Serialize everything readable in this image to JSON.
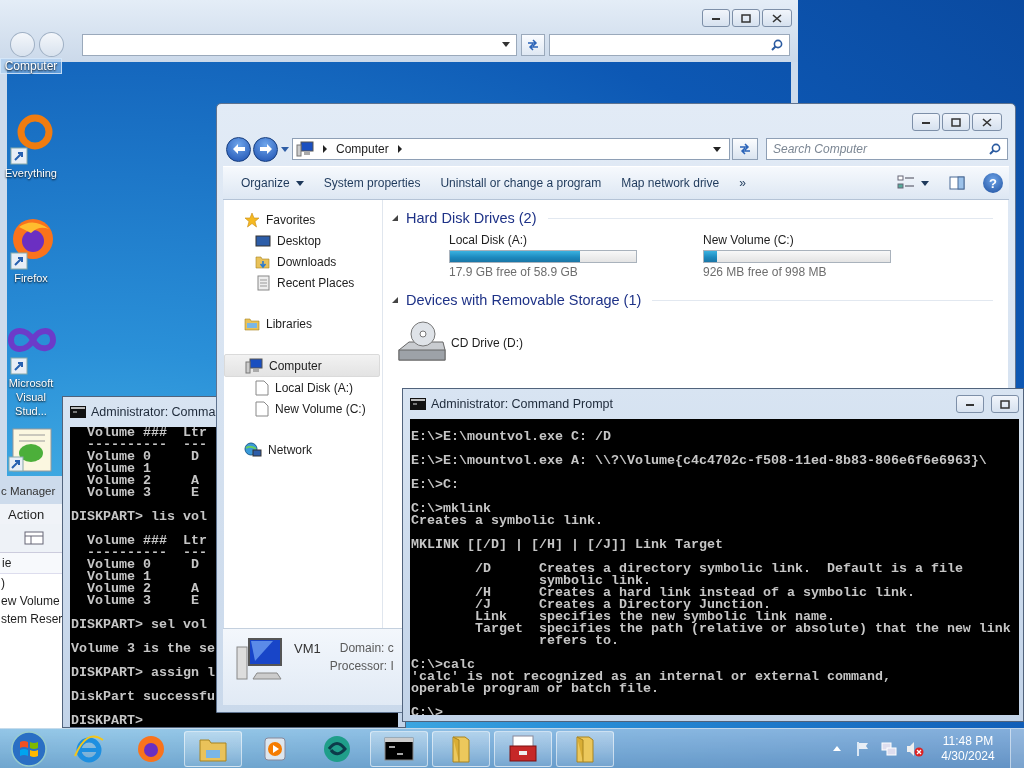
{
  "desktop": {
    "selected_label": "Computer",
    "icons": [
      {
        "kind": "ring",
        "label": "Everything"
      },
      {
        "kind": "globe",
        "label": "Firefox"
      },
      {
        "kind": "infinity",
        "label": "Microsoft Visual Stud..."
      },
      {
        "kind": "notepad"
      }
    ]
  },
  "disk_management": {
    "title": "c Manager",
    "menu": [
      "Action"
    ],
    "column_header": "ie",
    "rows": [
      ")",
      "ew Volume",
      "stem Reser"
    ]
  },
  "diskpart_console": {
    "title": "Administrator: Comma",
    "blocks": [
      [
        "  Volume ###  Ltr",
        "  ----------  ---",
        "  Volume 0     D",
        "  Volume 1",
        "  Volume 2     A",
        "  Volume 3     E"
      ],
      [
        "DISKPART> lis vol"
      ],
      [
        "  Volume ###  Ltr",
        "  ----------  ---",
        "  Volume 0     D",
        "  Volume 1",
        "  Volume 2     A",
        "  Volume 3     E"
      ],
      [
        "DISKPART> sel vol"
      ],
      [
        "Volume 3 is the se"
      ],
      [
        "DISKPART> assign l"
      ],
      [
        "DiskPart successfu"
      ],
      [
        "DISKPART>"
      ]
    ]
  },
  "explorer": {
    "breadcrumb": [
      "Computer"
    ],
    "search": {
      "placeholder": "Search Computer"
    },
    "toolbar": [
      {
        "label": "Organize",
        "dropdown": true
      },
      {
        "label": "System properties",
        "dropdown": false
      },
      {
        "label": "Uninstall or change a program",
        "dropdown": false
      },
      {
        "label": "Map network drive",
        "dropdown": false
      },
      {
        "label": "»",
        "dropdown": false
      }
    ],
    "help": "?",
    "nav": [
      {
        "kind": "star",
        "label": "Favorites",
        "selected": false,
        "children": [
          {
            "kind": "desktop",
            "label": "Desktop",
            "selected": false
          },
          {
            "kind": "downloads",
            "label": "Downloads",
            "selected": false
          },
          {
            "kind": "recent",
            "label": "Recent Places",
            "selected": false
          }
        ]
      },
      {
        "kind": "libraries",
        "label": "Libraries",
        "selected": false
      },
      {
        "kind": "computer",
        "label": "Computer",
        "selected": true,
        "children": [
          {
            "kind": "page",
            "label": "Local Disk (A:)",
            "selected": false
          },
          {
            "kind": "page",
            "label": "New Volume (C:)",
            "selected": false
          }
        ]
      },
      {
        "kind": "network",
        "label": "Network",
        "selected": false
      }
    ],
    "sections": [
      {
        "title": "Hard Disk Drives (2)",
        "expanded": true,
        "items": [
          {
            "kind": "hard-disk",
            "name": "Local Disk (A:)",
            "level": 0.7,
            "free": "17.9 GB free of 58.9 GB"
          },
          {
            "kind": "hard-disk",
            "name": "New Volume (C:)",
            "level": 0.07,
            "free": "926 MB free of 998 MB"
          }
        ]
      },
      {
        "title": "Devices with Removable Storage (1)",
        "expanded": true,
        "items": [
          {
            "kind": "cd-drive",
            "name": "CD Drive (D:)"
          }
        ]
      }
    ],
    "details": {
      "name": "VM1",
      "fields": [
        "Domain: c",
        "Processor: I"
      ]
    }
  },
  "console": {
    "title": "Administrator: Command Prompt",
    "blocks": [
      [
        "E:\\>E:\\mountvol.exe C: /D"
      ],
      [
        "E:\\>E:\\mountvol.exe A: \\\\?\\Volume{c4c4702c-f508-11ed-8b83-806e6f6e6963}\\"
      ],
      [
        "E:\\>C:"
      ],
      [
        "C:\\>mklink",
        "Creates a symbolic link."
      ],
      [
        "MKLINK [[/D] | [/H] | [/J]] Link Target"
      ],
      [
        "        /D      Creates a directory symbolic link.  Default is a file",
        "                symbolic link.",
        "        /H      Creates a hard link instead of a symbolic link.",
        "        /J      Creates a Directory Junction.",
        "        Link    specifies the new symbolic link name.",
        "        Target  specifies the path (relative or absolute) that the new link",
        "                refers to."
      ],
      [
        "C:\\>calc",
        "'calc' is not recognized as an internal or external command,",
        "operable program or batch file."
      ],
      [
        "C:\\>"
      ]
    ]
  },
  "taskbar": {
    "apps": [
      {
        "kind": "ie",
        "running": false
      },
      {
        "kind": "firefox",
        "running": false
      },
      {
        "kind": "explorer",
        "running": true
      },
      {
        "kind": "media",
        "running": false
      },
      {
        "kind": "swirl",
        "running": false
      },
      {
        "kind": "console",
        "running": true
      },
      {
        "kind": "folder",
        "running": true
      },
      {
        "kind": "toolbox",
        "running": true
      },
      {
        "kind": "folder",
        "running": true
      }
    ],
    "clock": {
      "time": "11:48 PM",
      "date": "4/30/2024"
    }
  }
}
